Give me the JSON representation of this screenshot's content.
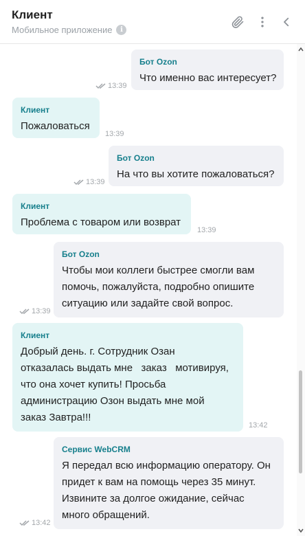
{
  "header": {
    "title": "Клиент",
    "subtitle": "Мобильное приложение",
    "info_glyph": "i",
    "icons": [
      "paperclip-icon",
      "more-vertical-icon",
      "chevron-left-icon"
    ]
  },
  "colors": {
    "bot_bubble": "#f0f1f5",
    "client_bubble": "#e3f5f5",
    "sender_name": "#167f8c",
    "time_text": "#a3a7ab"
  },
  "messages": [
    {
      "author": "bot",
      "sender": "Бот Ozon",
      "lines": [
        "Что именно вас интересует?"
      ],
      "time": "13:39",
      "read": true
    },
    {
      "author": "client",
      "sender": "Клиент",
      "lines": [
        "Пожаловаться"
      ],
      "time": "13:39"
    },
    {
      "author": "bot",
      "sender": "Бот Ozon",
      "lines": [
        "На что вы хотите пожаловаться?"
      ],
      "time": "13:39",
      "read": true
    },
    {
      "author": "client",
      "sender": "Клиент",
      "lines": [
        "Проблема с товаром или возврат"
      ],
      "time": "13:39"
    },
    {
      "author": "bot",
      "sender": "Бот Ozon",
      "lines": [
        "Чтобы мои коллеги быстрее смогли вам",
        "помочь, пожалуйста, подробно опишите",
        "ситуацию или задайте свой вопрос."
      ],
      "time": "13:39",
      "read": true
    },
    {
      "author": "client",
      "sender": "Клиент",
      "lines": [
        "Добрый день. г. Сотрудник Озан",
        "отказалась выдать мне   заказ   мотивируя,",
        "что она хочет купить! Просьба",
        "администрацию Озон выдать мне мой",
        "заказ Завтра!!!"
      ],
      "time": "13:42"
    },
    {
      "author": "bot",
      "sender": "Сервис WebCRM",
      "lines": [
        "Я передал всю информацию оператору. Он",
        "придет к вам на помощь через 35 минут.",
        "Извините за долгое ожидание, сейчас",
        "много обращений."
      ],
      "time": "13:42",
      "read": true
    }
  ]
}
